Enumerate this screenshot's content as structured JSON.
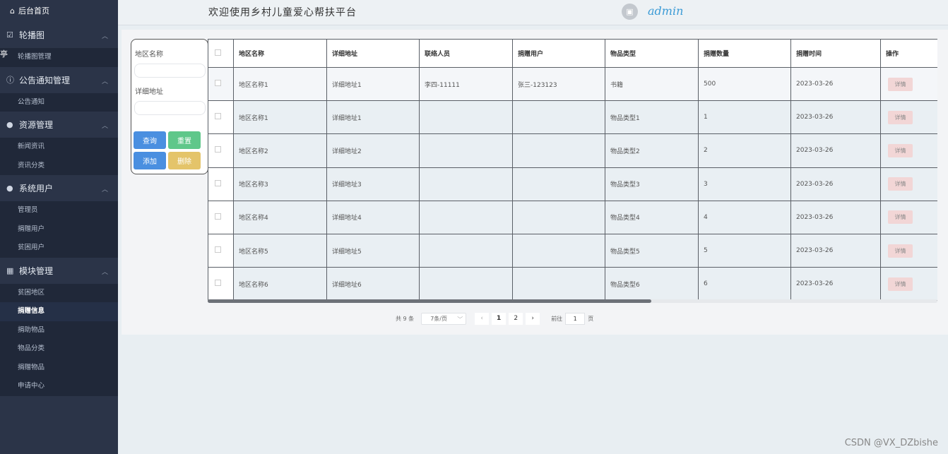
{
  "sidebar": {
    "home": "后台首页",
    "stray_char": "亭",
    "groups": [
      {
        "label": "轮播图",
        "items": [
          "轮播图管理"
        ]
      },
      {
        "label": "公告通知管理",
        "items": [
          "公告通知"
        ]
      },
      {
        "label": "资源管理",
        "items": [
          "新闻资讯",
          "资讯分类"
        ]
      },
      {
        "label": "系统用户",
        "items": [
          "管理员",
          "捐赠用户",
          "贫困用户"
        ]
      },
      {
        "label": "模块管理",
        "items": [
          "贫困地区",
          "捐赠信息",
          "捐助物品",
          "物品分类",
          "捐赠物品",
          "申请中心"
        ]
      }
    ],
    "active_item": "捐赠信息"
  },
  "header": {
    "title": "欢迎使用乡村儿童爱心帮扶平台",
    "username": "admin"
  },
  "search": {
    "region_label": "地区名称",
    "region_value": "",
    "address_label": "详细地址",
    "address_value": "",
    "query_btn": "查询",
    "reset_btn": "重置",
    "add_btn": "添加",
    "delete_btn": "删除"
  },
  "table": {
    "headers": [
      "地区名称",
      "详细地址",
      "联络人员",
      "捐赠用户",
      "物品类型",
      "捐赠数量",
      "捐赠时间",
      "操作"
    ],
    "action_label": "详情",
    "rows": [
      [
        "地区名称1",
        "详细地址1",
        "李四-11111",
        "张三-123123",
        "书籍",
        "500",
        "2023-03-26"
      ],
      [
        "地区名称1",
        "详细地址1",
        "",
        "",
        "物品类型1",
        "1",
        "2023-03-26"
      ],
      [
        "地区名称2",
        "详细地址2",
        "",
        "",
        "物品类型2",
        "2",
        "2023-03-26"
      ],
      [
        "地区名称3",
        "详细地址3",
        "",
        "",
        "物品类型3",
        "3",
        "2023-03-26"
      ],
      [
        "地区名称4",
        "详细地址4",
        "",
        "",
        "物品类型4",
        "4",
        "2023-03-26"
      ],
      [
        "地区名称5",
        "详细地址5",
        "",
        "",
        "物品类型5",
        "5",
        "2023-03-26"
      ],
      [
        "地区名称6",
        "详细地址6",
        "",
        "",
        "物品类型6",
        "6",
        "2023-03-26"
      ]
    ]
  },
  "pager": {
    "total": "共 9 条",
    "page_size": "7条/页",
    "pages": [
      "1",
      "2"
    ],
    "goto_label": "前往",
    "goto_value": "1",
    "goto_suffix": "页"
  },
  "watermark": "CSDN @VX_DZbishe",
  "colors": {
    "sidebar_bg": "#2b3448",
    "accent_blue": "#4a8fe0",
    "accent_green": "#5fc78a",
    "accent_yellow": "#e4c46a",
    "detail_btn": "#f2d6d6"
  }
}
